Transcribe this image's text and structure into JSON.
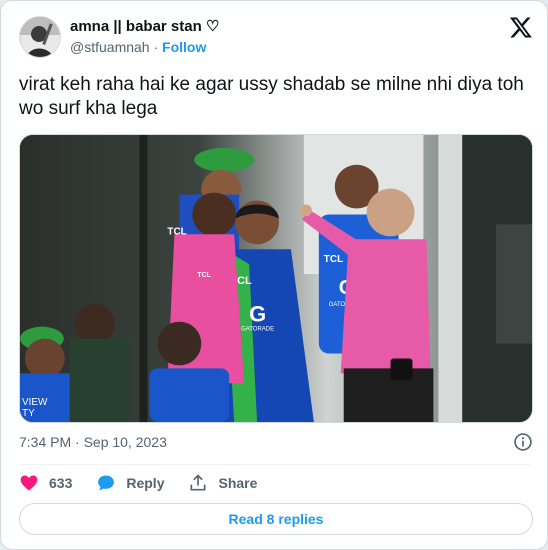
{
  "author": {
    "display_name": "amna || babar stan ♡",
    "handle": "@stfuamnah",
    "separator": "·",
    "follow_label": "Follow"
  },
  "tweet": {
    "text": "virat keh raha hai ke agar ussy shadab se milne nhi diya toh wo surf kha lega",
    "time": "7:34 PM · Sep 10, 2023"
  },
  "media": {
    "jersey_texts": [
      "TCL",
      "CL",
      "TCL",
      "G",
      "GATORADE",
      "TCL",
      "G",
      "GATORADE",
      "VIEW",
      "TY"
    ]
  },
  "actions": {
    "likes": "633",
    "reply_label": "Reply",
    "share_label": "Share"
  },
  "replies_button": "Read 8 replies",
  "colors": {
    "accent": "#1d9bf0",
    "heart": "#f91880",
    "text_muted": "#536471"
  }
}
